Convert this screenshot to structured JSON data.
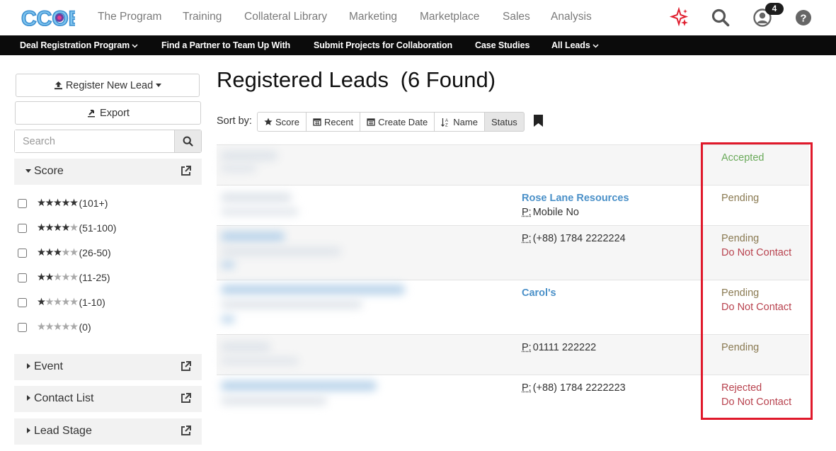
{
  "nav": {
    "logo_text": "CCOE",
    "links": [
      "The Program",
      "Training",
      "Collateral Library",
      "Marketing",
      "Marketplace",
      "Sales",
      "Analysis"
    ],
    "notification_count": "4"
  },
  "subnav": {
    "items": [
      "Deal Registration Program",
      "Find a Partner to Team Up With",
      "Submit Projects for Collaboration",
      "Case Studies",
      "All Leads"
    ]
  },
  "sidebar": {
    "register_label": "Register New Lead",
    "export_label": "Export",
    "search_placeholder": "Search",
    "score_title": "Score",
    "score_options": [
      {
        "filled": 5,
        "label": "(101+)"
      },
      {
        "filled": 4,
        "label": "(51-100)"
      },
      {
        "filled": 3,
        "label": "(26-50)"
      },
      {
        "filled": 2,
        "label": "(11-25)"
      },
      {
        "filled": 1,
        "label": "(1-10)"
      },
      {
        "filled": 0,
        "label": "(0)"
      }
    ],
    "facets": [
      "Event",
      "Contact List",
      "Lead Stage"
    ]
  },
  "main": {
    "title": "Registered Leads",
    "count": "(6 Found)",
    "sort_label": "Sort by:",
    "sort_buttons": [
      "Score",
      "Recent",
      "Create Date",
      "Name",
      "Status"
    ],
    "leads": [
      {
        "company": "",
        "phone_prefix": "",
        "phone": "",
        "statuses": [
          "Accepted"
        ]
      },
      {
        "company": "Rose Lane Resources",
        "phone_prefix": "P:",
        "phone": "Mobile No",
        "statuses": [
          "Pending"
        ]
      },
      {
        "company": "",
        "phone_prefix": "P:",
        "phone": "(+88) 1784 2222224",
        "statuses": [
          "Pending",
          "Do Not Contact"
        ]
      },
      {
        "company": "Carol's",
        "phone_prefix": "",
        "phone": "",
        "statuses": [
          "Pending",
          "Do Not Contact"
        ]
      },
      {
        "company": "",
        "phone_prefix": "P:",
        "phone": "01111 222222",
        "statuses": [
          "Pending"
        ]
      },
      {
        "company": "",
        "phone_prefix": "P:",
        "phone": "(+88) 1784 2222223",
        "statuses": [
          "Rejected",
          "Do Not Contact"
        ]
      }
    ]
  },
  "colors": {
    "accepted": "#6aaa5a",
    "pending": "#8a7a52",
    "rejected_do_not_contact": "#b8424e",
    "link_blue": "#4a90c8",
    "highlight": "#e0192b"
  }
}
